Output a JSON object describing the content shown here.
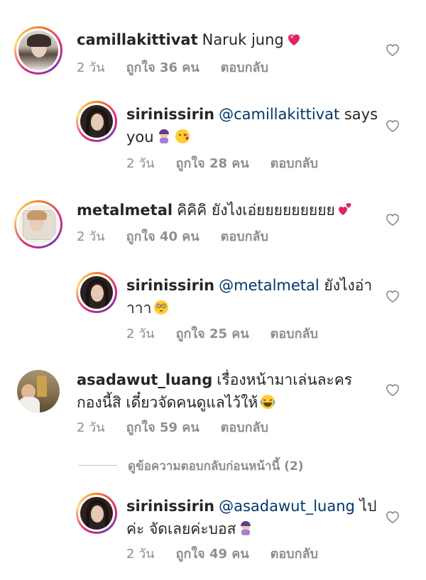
{
  "colors": {
    "text": "#262626",
    "secondary": "#8e8e8e",
    "mention": "#00376b"
  },
  "comments": [
    {
      "username": "camillakittivat",
      "text": "Naruk jung",
      "emoji": "heart-emoji",
      "time": "2 วัน",
      "likes": "ถูกใจ 36 คน",
      "reply": "ตอบกลับ"
    },
    {
      "username": "sirinissirin",
      "mention": "@camillakittivat",
      "text_a": " says",
      "text_b": "you",
      "emoji": "facepalm-kiss-emoji",
      "time": "2 วัน",
      "likes": "ถูกใจ 28 คน",
      "reply": "ตอบกลับ"
    },
    {
      "username": "metalmetal",
      "text": "คิคิคิ ยังไงเอ่ยยยยยยยยย",
      "emoji": "two-hearts-emoji",
      "time": "2 วัน",
      "likes": "ถูกใจ 40 คน",
      "reply": "ตอบกลับ"
    },
    {
      "username": "sirinissirin",
      "mention": "@metalmetal",
      "text_a": " ยังไงอ่า",
      "text_b": "าาา",
      "emoji": "flushed-emoji",
      "time": "2 วัน",
      "likes": "ถูกใจ 25 คน",
      "reply": "ตอบกลับ"
    },
    {
      "username": "asadawut_luang",
      "text_a": "เรื่องหน้ามาเล่นละคร",
      "text_b": "กองนี้สิ เดี๋ยวจัดคนดูแลไว้ให้",
      "emoji": "laughing-emoji",
      "time": "2 วัน",
      "likes": "ถูกใจ 59 คน",
      "reply": "ตอบกลับ"
    },
    {
      "username": "sirinissirin",
      "mention": "@asadawut_luang",
      "text_a": " ไป",
      "text_b": "ค่ะ จัดเลยค่ะบอส",
      "emoji": "facepalm-emoji",
      "time": "2 วัน",
      "likes": "ถูกใจ 49 คน",
      "reply": "ตอบกลับ"
    }
  ],
  "view_previous": "ดูข้อความตอบกลับก่อนหน้านี้ (2)"
}
